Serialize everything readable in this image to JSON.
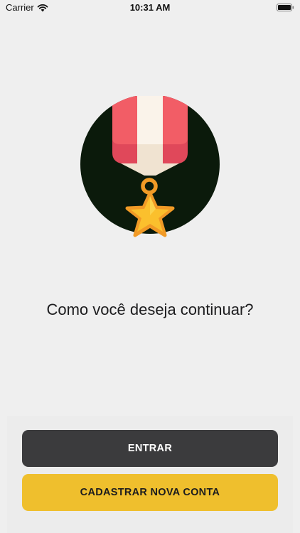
{
  "status_bar": {
    "carrier": "Carrier",
    "time": "10:31 AM",
    "wifi_icon": "wifi-icon",
    "battery_icon": "battery-full-icon"
  },
  "hero": {
    "icon": "medal-icon",
    "circle_color": "#0b1a0b",
    "ribbon_colors": [
      "#f25d66",
      "#faf3ea",
      "#e0485a"
    ],
    "star_color": "#fbc02d"
  },
  "question": {
    "text": "Como você deseja continuar?"
  },
  "actions": {
    "enter_label": "ENTRAR",
    "register_label": "CADASTRAR NOVA CONTA"
  },
  "colors": {
    "background": "#efefef",
    "enter_button": "#3b3b3d",
    "register_button": "#efbf2d"
  }
}
